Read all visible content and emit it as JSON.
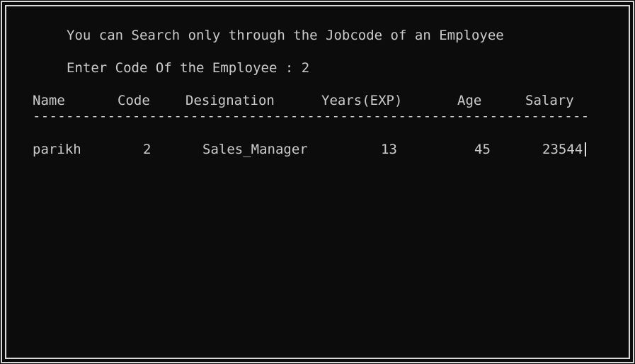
{
  "prompt_info": "You can Search only through the Jobcode of an Employee",
  "prompt_input": "Enter Code Of the Employee : 2",
  "table": {
    "headers": [
      "Name",
      "Code",
      "Designation",
      "Years(EXP)",
      "Age",
      "Salary"
    ],
    "separator": "-------------------------------------------------------------------",
    "rows": [
      [
        "parikh",
        "2",
        "Sales_Manager",
        "13",
        "45",
        "23544"
      ]
    ]
  }
}
